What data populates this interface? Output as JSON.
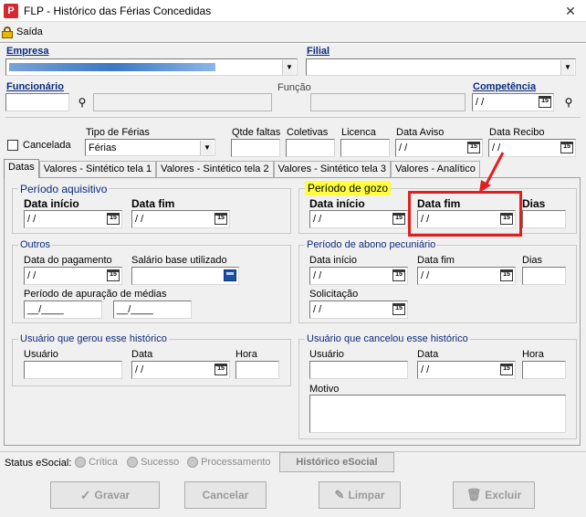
{
  "window": {
    "title": "FLP - Histórico das Férias Concedidas",
    "close": "✕",
    "app_icon": "P"
  },
  "menu": {
    "saida": "Saída"
  },
  "header": {
    "empresa_label": "Empresa",
    "filial_label": "Filial",
    "funcionario_label": "Funcionário",
    "funcao_label": "Função",
    "competencia_label": "Competência",
    "competencia_value": " / /"
  },
  "ferias": {
    "cancelada_label": "Cancelada",
    "tipo_label": "Tipo de Férias",
    "tipo_value": "Férias",
    "qtde_faltas_label": "Qtde faltas",
    "coletivas_label": "Coletivas",
    "licenca_label": "Licenca",
    "data_aviso_label": "Data Aviso",
    "data_aviso_value": " / /",
    "data_recibo_label": "Data Recibo",
    "data_recibo_value": " / /"
  },
  "tabs": [
    {
      "label": "Datas"
    },
    {
      "label": "Valores - Sintético tela 1"
    },
    {
      "label": "Valores - Sintético tela 2"
    },
    {
      "label": "Valores - Sintético tela 3"
    },
    {
      "label": "Valores - Analítico"
    }
  ],
  "periodo_aquisitivo": {
    "title": "Período aquisitivo",
    "data_inicio_label": "Data início",
    "data_inicio_value": " / /",
    "data_fim_label": "Data fim",
    "data_fim_value": " / /"
  },
  "periodo_gozo": {
    "title": "Período de gozo",
    "data_inicio_label": "Data início",
    "data_inicio_value": " / /",
    "data_fim_label": "Data fim",
    "data_fim_value": " / /",
    "dias_label": "Dias"
  },
  "outros": {
    "title": "Outros",
    "data_pagamento_label": "Data do pagamento",
    "data_pagamento_value": " / /",
    "salario_label": "Salário base utilizado",
    "periodo_apuracao_label": "Período de apuração de médias",
    "periodo_apuracao_from": "__/____",
    "periodo_apuracao_to": "__/____"
  },
  "abono": {
    "title": "Período de abono pecuniário",
    "data_inicio_label": "Data início",
    "data_inicio_value": " / /",
    "data_fim_label": "Data fim",
    "data_fim_value": " / /",
    "dias_label": "Dias",
    "solicitacao_label": "Solicitação",
    "solicitacao_value": " / /"
  },
  "usuario_gerou": {
    "title": "Usuário que gerou esse histórico",
    "usuario_label": "Usuário",
    "data_label": "Data",
    "data_value": " / /",
    "hora_label": "Hora"
  },
  "usuario_cancelou": {
    "title": "Usuário que cancelou esse histórico",
    "usuario_label": "Usuário",
    "data_label": "Data",
    "data_value": " / /",
    "hora_label": "Hora",
    "motivo_label": "Motivo"
  },
  "status_esocial": {
    "label": "Status eSocial:",
    "critica": "Crítica",
    "sucesso": "Sucesso",
    "processamento": "Processamento",
    "historico_button": "Histórico eSocial"
  },
  "buttons": {
    "gravar": "Gravar",
    "cancelar": "Cancelar",
    "limpar": "Limpar",
    "excluir": "Excluir"
  },
  "colors": {
    "title_blue": "#0a2a7a",
    "highlight_yellow": "#ffff40",
    "annotation_red": "#e02020"
  }
}
